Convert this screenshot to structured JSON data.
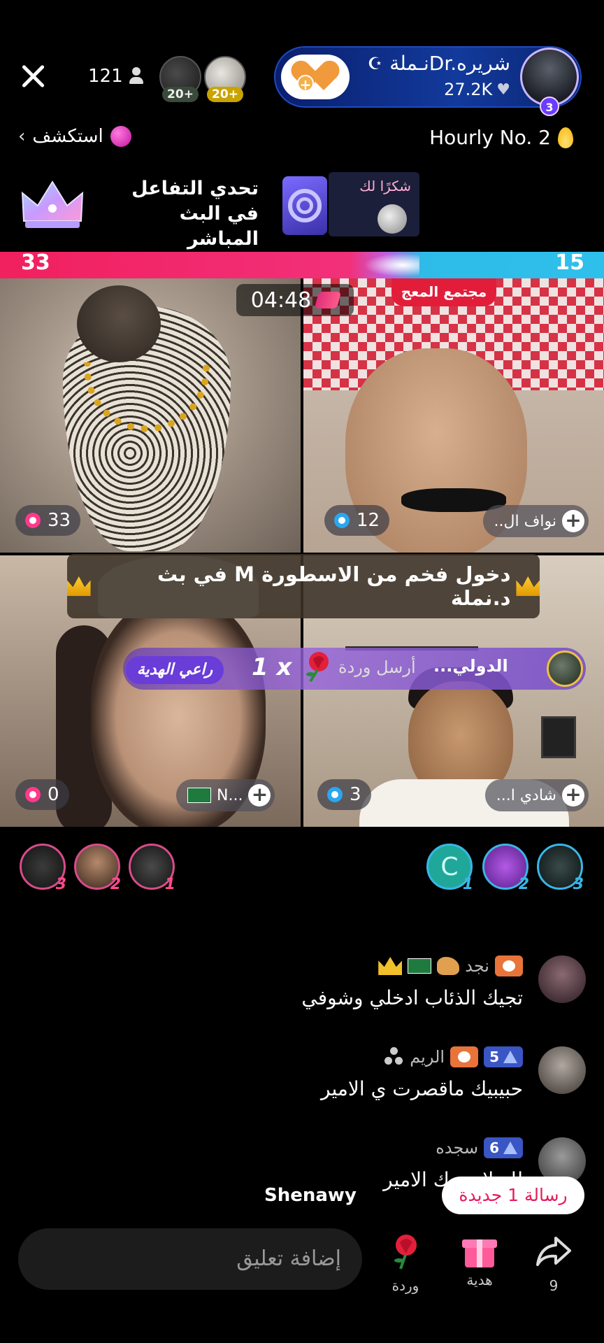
{
  "header": {
    "viewer_count": "121",
    "top_viewers": [
      {
        "badge": "20+"
      },
      {
        "badge": "20+"
      }
    ],
    "host": {
      "name": "نـملةDr.شريره",
      "likes": "27.2K",
      "level": "3"
    }
  },
  "subheader": {
    "explore_label": "استكشف",
    "hourly_label": "Hourly No. 2"
  },
  "challenge": {
    "title": "تحدي التفاعل في البث المباشر",
    "thanks_label": "شكرًا لك"
  },
  "pk": {
    "left_score": "33",
    "right_score": "15",
    "timer": "04:48",
    "banner_label": "مجتمع المعج"
  },
  "tiles": [
    {
      "score": "33"
    },
    {
      "score": "12",
      "name": "نواف ال.."
    },
    {
      "score": "0",
      "name": "N..."
    },
    {
      "score": "3",
      "name": "شادي ا..."
    }
  ],
  "entry_banner": {
    "text": "دخول فخم من الاسطورة M في بث د.نملة"
  },
  "gift_notice": {
    "sponsor_tag": "راعي الهدية",
    "count": "1 x",
    "action": "أرسل وردة",
    "sender": "الدولي..."
  },
  "contributors": {
    "left_ranks": [
      "3",
      "2",
      "1"
    ],
    "right": [
      {
        "rank": "1",
        "letter": "C"
      },
      {
        "rank": "2"
      },
      {
        "rank": "3"
      }
    ]
  },
  "chat": [
    {
      "user": "نجد",
      "text": "تجيك الذئاب ادخلي وشوفي"
    },
    {
      "user": "الريم",
      "level": "5",
      "text": "حبيبيك ماقصرت ي الامير"
    },
    {
      "user": "سجده",
      "level": "6",
      "text": "لله لايضرك الامير"
    }
  ],
  "new_message_label": "رسالة 1 جديدة",
  "watermark": "Shenawy",
  "bottom_bar": {
    "comment_placeholder": "إضافة تعليق",
    "rose_label": "وردة",
    "gift_label": "هدية",
    "share_count": "9"
  },
  "colors": {
    "pk_left": "#f1205e",
    "pk_right": "#2ebbe8",
    "host_pill": "#123a9c",
    "new_message_text": "#e41d5a"
  }
}
